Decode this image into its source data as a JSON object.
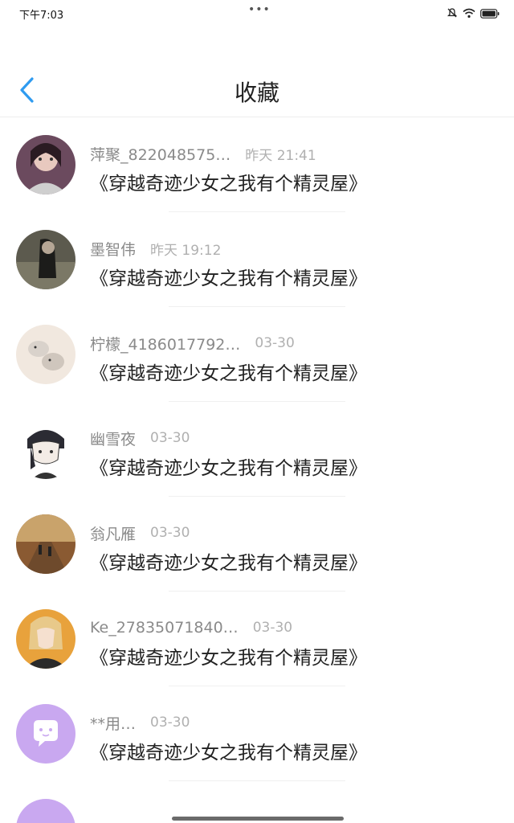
{
  "status_bar": {
    "time": "下午7:03",
    "dots": "•••"
  },
  "header": {
    "title": "收藏"
  },
  "items": [
    {
      "user": "萍聚_822048575…",
      "time": "昨天 21:41",
      "book": "《穿越奇迹少女之我有个精灵屋》"
    },
    {
      "user": "墨智伟",
      "time": "昨天 19:12",
      "book": "《穿越奇迹少女之我有个精灵屋》"
    },
    {
      "user": "柠檬_4186017792…",
      "time": "03-30",
      "book": "《穿越奇迹少女之我有个精灵屋》"
    },
    {
      "user": "幽雪夜",
      "time": "03-30",
      "book": "《穿越奇迹少女之我有个精灵屋》"
    },
    {
      "user": "翁凡雁",
      "time": "03-30",
      "book": "《穿越奇迹少女之我有个精灵屋》"
    },
    {
      "user": "Ke_27835071840…",
      "time": "03-30",
      "book": "《穿越奇迹少女之我有个精灵屋》"
    },
    {
      "user": "**用…",
      "time": "03-30",
      "book": "《穿越奇迹少女之我有个精灵屋》"
    }
  ],
  "colors": {
    "accent": "#2f9bf0",
    "placeholder_avatar": "#c9a8f0"
  }
}
